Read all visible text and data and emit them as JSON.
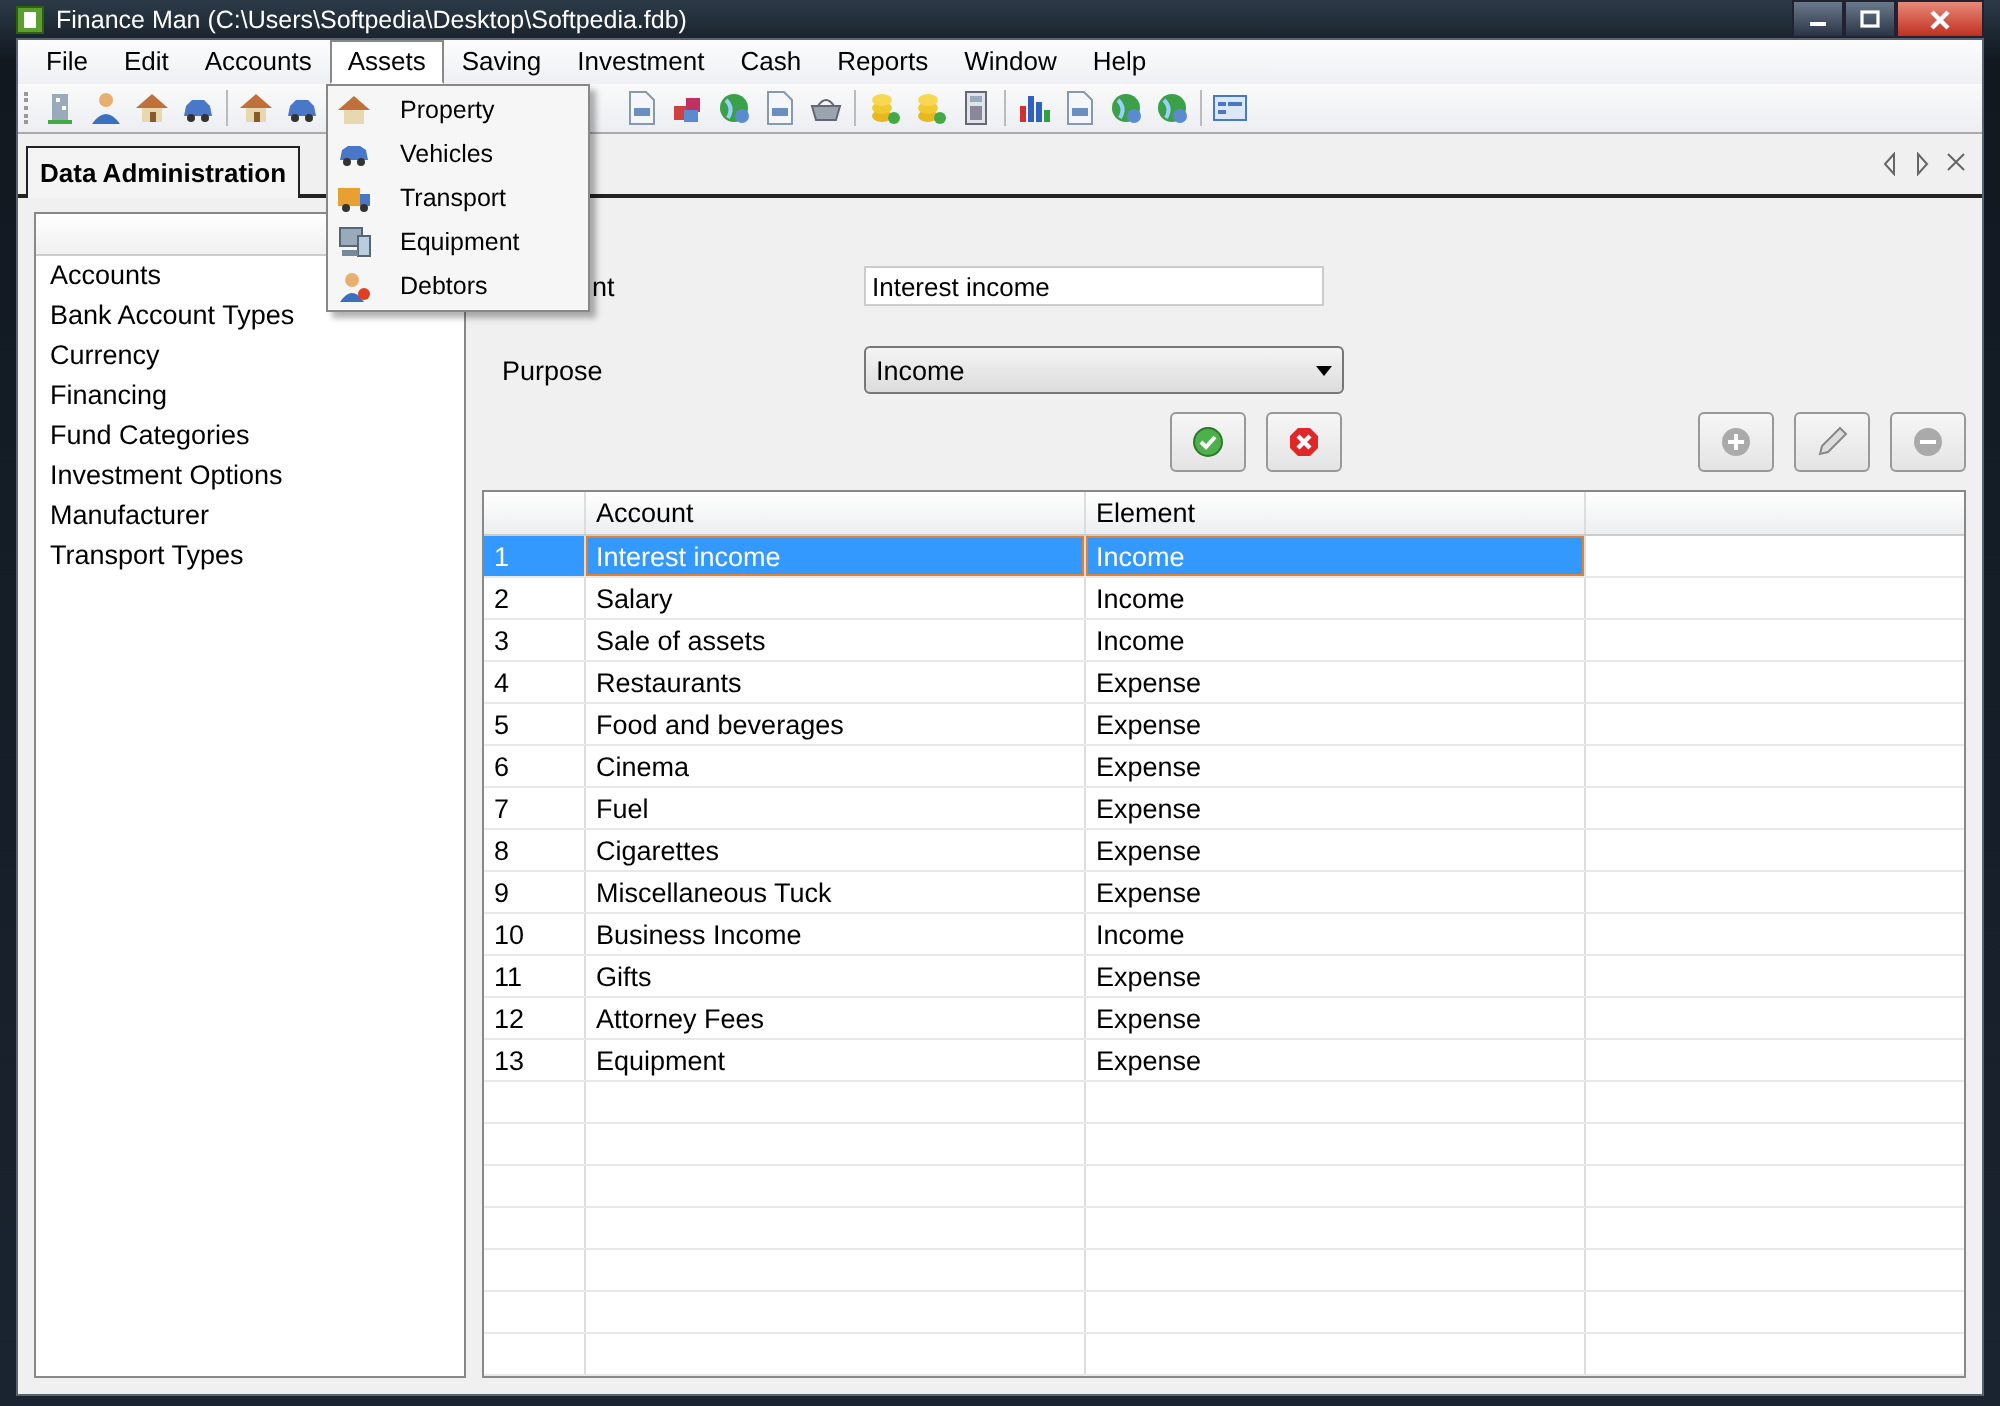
{
  "window": {
    "title": "Finance Man (C:\\Users\\Softpedia\\Desktop\\Softpedia.fdb)"
  },
  "menu": [
    {
      "label": "File",
      "selected": false
    },
    {
      "label": "Edit",
      "selected": false
    },
    {
      "label": "Accounts",
      "selected": false
    },
    {
      "label": "Assets",
      "selected": true
    },
    {
      "label": "Saving",
      "selected": false
    },
    {
      "label": "Investment",
      "selected": false
    },
    {
      "label": "Cash",
      "selected": false
    },
    {
      "label": "Reports",
      "selected": false
    },
    {
      "label": "Window",
      "selected": false
    },
    {
      "label": "Help",
      "selected": false
    }
  ],
  "dropdown": [
    {
      "label": "Property",
      "kind": "house"
    },
    {
      "label": "Vehicles",
      "kind": "car"
    },
    {
      "label": "Transport",
      "kind": "truck"
    },
    {
      "label": "Equipment",
      "kind": "computer"
    },
    {
      "label": "Debtors",
      "kind": "person"
    }
  ],
  "tab": {
    "label": "Data Administration"
  },
  "sidebar": {
    "items": [
      "Accounts",
      "Bank Account Types",
      "Currency",
      "Financing",
      "Fund Categories",
      "Investment Options",
      "Manufacturer",
      "Transport Types"
    ]
  },
  "form": {
    "account_label": "nt",
    "account_value": "Interest income",
    "purpose_label": "Purpose",
    "purpose_value": "Income"
  },
  "table": {
    "columns": [
      "Account",
      "Element"
    ],
    "rows": [
      {
        "number": "1",
        "account": "Interest income",
        "element": "Income",
        "selected": true
      },
      {
        "number": "2",
        "account": "Salary",
        "element": "Income",
        "selected": false
      },
      {
        "number": "3",
        "account": "Sale of assets",
        "element": "Income",
        "selected": false
      },
      {
        "number": "4",
        "account": "Restaurants",
        "element": "Expense",
        "selected": false
      },
      {
        "number": "5",
        "account": "Food and beverages",
        "element": "Expense",
        "selected": false
      },
      {
        "number": "6",
        "account": "Cinema",
        "element": "Expense",
        "selected": false
      },
      {
        "number": "7",
        "account": "Fuel",
        "element": "Expense",
        "selected": false
      },
      {
        "number": "8",
        "account": "Cigarettes",
        "element": "Expense",
        "selected": false
      },
      {
        "number": "9",
        "account": "Miscellaneous Tuck",
        "element": "Expense",
        "selected": false
      },
      {
        "number": "10",
        "account": "Business Income",
        "element": "Income",
        "selected": false
      },
      {
        "number": "11",
        "account": "Gifts",
        "element": "Expense",
        "selected": false
      },
      {
        "number": "12",
        "account": "Attorney Fees",
        "element": "Expense",
        "selected": false
      },
      {
        "number": "13",
        "account": "Equipment",
        "element": "Expense",
        "selected": false
      }
    ]
  }
}
